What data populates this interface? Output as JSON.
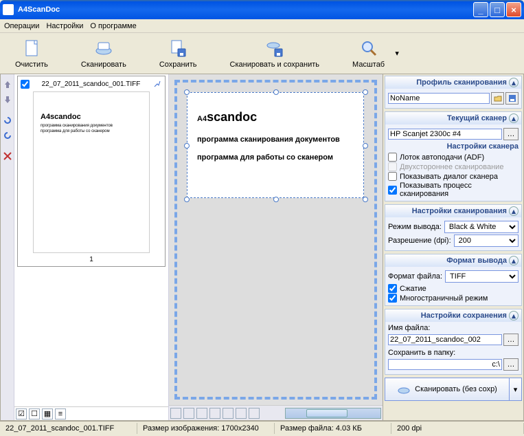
{
  "window": {
    "title": "A4ScanDoc"
  },
  "menu": {
    "ops": "Операции",
    "settings": "Настройки",
    "about": "О программе"
  },
  "toolbar": {
    "clear": "Очистить",
    "scan": "Сканировать",
    "save": "Сохранить",
    "scan_save": "Сканировать и сохранить",
    "zoom": "Масштаб"
  },
  "thumb": {
    "filename": "22_07_2011_scandoc_001.TIFF",
    "page_num": "1",
    "preview_title": "A4scandoc",
    "preview_l1": "программа сканирования документов",
    "preview_l2": "программа для работы со сканером"
  },
  "preview": {
    "title_main": "A4",
    "title_sub": "scandoc",
    "line1": "программа сканирования  документов",
    "line2": "программа для работы со сканером"
  },
  "panels": {
    "profile": {
      "title": "Профиль сканирования",
      "value": "NoName"
    },
    "scanner": {
      "title": "Текущий сканер",
      "value": "HP Scanjet 2300c #4",
      "section": "Настройки сканера",
      "adf": "Лоток автоподачи (ADF)",
      "duplex": "Двухстороннее сканирование",
      "dialog": "Показывать диалог сканера",
      "progress": "Показывать процесс сканирования"
    },
    "scan": {
      "title": "Настройки сканирования",
      "mode_label": "Режим вывода:",
      "mode_value": "Black & White",
      "dpi_label": "Разрешение (dpi):",
      "dpi_value": "200"
    },
    "output": {
      "title": "Формат вывода",
      "format_label": "Формат файла:",
      "format_value": "TIFF",
      "compress": "Сжатие",
      "multipage": "Многостраничный режим"
    },
    "save": {
      "title": "Настройки сохранения",
      "name_label": "Имя файла:",
      "name_value": "22_07_2011_scandoc_002",
      "folder_label": "Сохранить в папку:",
      "folder_value": "c:\\"
    },
    "scan_btn": "Сканировать (без сохр)"
  },
  "status": {
    "file": "22_07_2011_scandoc_001.TIFF",
    "img_size_label": "Размер изображения:",
    "img_size": "1700x2340",
    "file_size_label": "Размер файла:",
    "file_size": "4.03 КБ",
    "dpi": "200 dpi"
  }
}
